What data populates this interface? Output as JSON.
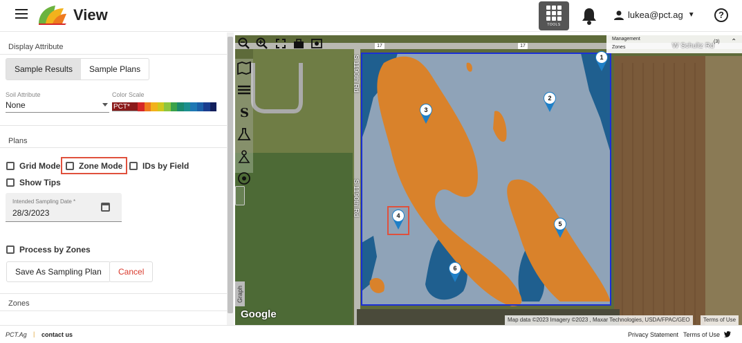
{
  "header": {
    "app_title": "View",
    "tools_label": "TOOLS",
    "user_email": "lukea@pct.ag",
    "help_glyph": "?"
  },
  "panel": {
    "display_attribute_title": "Display Attribute",
    "tabs": [
      {
        "label": "Sample Results",
        "active": true
      },
      {
        "label": "Sample Plans",
        "active": false
      }
    ],
    "soil_attribute_label": "Soil Attribute",
    "soil_attribute_value": "None",
    "color_scale_label": "Color Scale",
    "color_scale_value": "PCT*",
    "color_scale_colors": [
      "#d62728",
      "#ee7a1e",
      "#f2b21c",
      "#cfc81c",
      "#8dc63f",
      "#3aa24a",
      "#1a8a6e",
      "#1b8f8f",
      "#1f78b4",
      "#1c5fa8",
      "#1a3d8f",
      "#121f5c"
    ],
    "plans_title": "Plans",
    "checkboxes": {
      "grid_mode": "Grid Mode",
      "zone_mode": "Zone Mode",
      "ids_by_field": "IDs by Field",
      "show_tips": "Show Tips",
      "process_by_zones": "Process by Zones"
    },
    "date_label": "Intended Sampling Date *",
    "date_value": "28/3/2023",
    "save_button": "Save As Sampling Plan",
    "cancel_button": "Cancel",
    "zones_title": "Zones"
  },
  "map": {
    "management_zones_line1": "Management",
    "management_zones_line2": "Zones",
    "management_zones_count": "(3)",
    "road_top_right": "W Schultz Rd",
    "road_left_top": "S 1190th Rd",
    "road_left_bottom": "S 1190th Rd",
    "route_badge": "17",
    "graph_tab": "Graph",
    "google_logo": "Google",
    "attribution": "Map data ©2023 Imagery ©2023 , Maxar Technologies, USDA/FPAC/GEO",
    "terms": "Terms of Use",
    "markers": [
      "1",
      "2",
      "3",
      "4",
      "5",
      "6"
    ],
    "zone_colors": {
      "light": "#8fa3b8",
      "orange": "#d9822b",
      "dark": "#1f5f8f",
      "boundary": "#1a2fd6"
    }
  },
  "footer": {
    "brand": "PCT.Ag",
    "separator": "|",
    "contact": "contact us",
    "privacy": "Privacy Statement",
    "terms": "Terms of Use"
  }
}
